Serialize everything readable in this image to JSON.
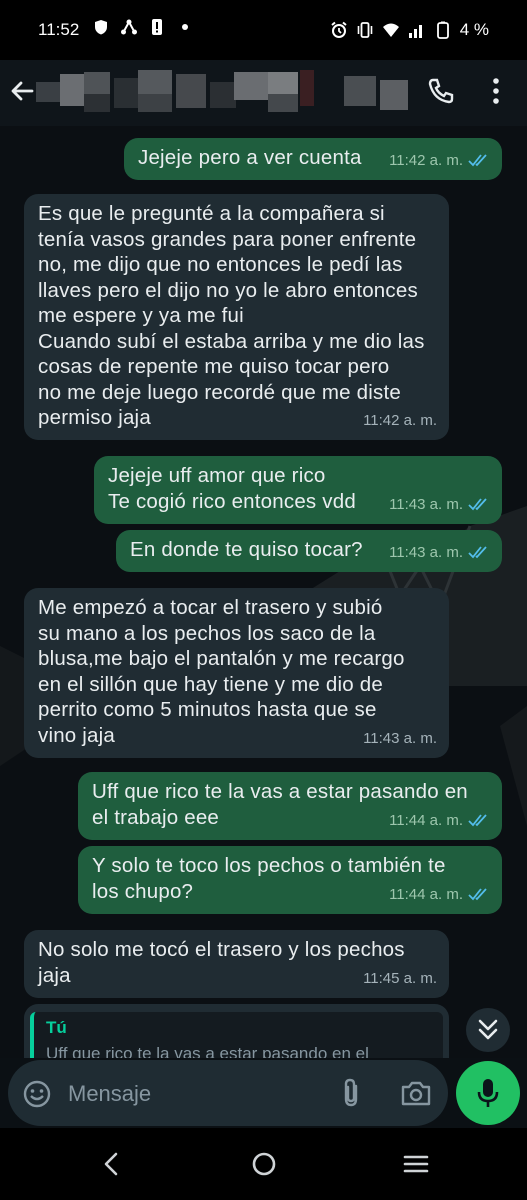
{
  "status_bar": {
    "time": "11:52",
    "battery": "4 %"
  },
  "composer": {
    "placeholder": "Mensaje"
  },
  "messages": [
    {
      "dir": "out",
      "text": "Jejeje pero a ver cuenta",
      "time": "11:42 a. m."
    },
    {
      "dir": "in",
      "text": "Es que le pregunté a la compañera si\ntenía vasos grandes para poner enfrente\nno, me dijo que no entonces le pedí las\nllaves pero el dijo no yo le abro entonces\nme espere y ya me fui\nCuando subí el estaba arriba y me dio las\ncosas de repente me quiso tocar pero\nno me deje luego recordé que me diste\npermiso jaja",
      "time": "11:42 a. m."
    },
    {
      "dir": "out",
      "text": "Jejeje uff amor que rico\nTe cogió rico entonces vdd",
      "time": "11:43 a. m."
    },
    {
      "dir": "out",
      "text": "En donde te quiso tocar?",
      "time": "11:43 a. m."
    },
    {
      "dir": "in",
      "text": "Me empezó a tocar el trasero y subió\nsu mano a los pechos los saco de la\nblusa,me bajo el pantalón y me recargo\nen el sillón que hay tiene y me dio de\nperrito como 5 minutos hasta que se\nvino jaja",
      "time": "11:43 a. m."
    },
    {
      "dir": "out",
      "text": "Uff que rico te la vas a estar pasando en\nel trabajo eee",
      "time": "11:44 a. m."
    },
    {
      "dir": "out",
      "text": "Y solo te toco los pechos o también te\nlos chupo?",
      "time": "11:44 a. m."
    },
    {
      "dir": "in",
      "text": "No solo me tocó el trasero y los pechos\njaja",
      "time": "11:45 a. m."
    }
  ],
  "reply_preview": {
    "author": "Tú",
    "text": "Uff que rico te la vas a estar pasando en el"
  },
  "colors": {
    "outgoing_bubble": "#1f5e3e",
    "incoming_bubble": "#202c33",
    "accent_green": "#21c063",
    "read_ticks": "#53bdeb"
  },
  "icons": [
    "back-arrow-icon",
    "call-icon",
    "more-vert-icon",
    "emoji-icon",
    "attach-icon",
    "camera-icon",
    "mic-icon",
    "double-chevron-down-icon",
    "read-ticks-icon"
  ]
}
